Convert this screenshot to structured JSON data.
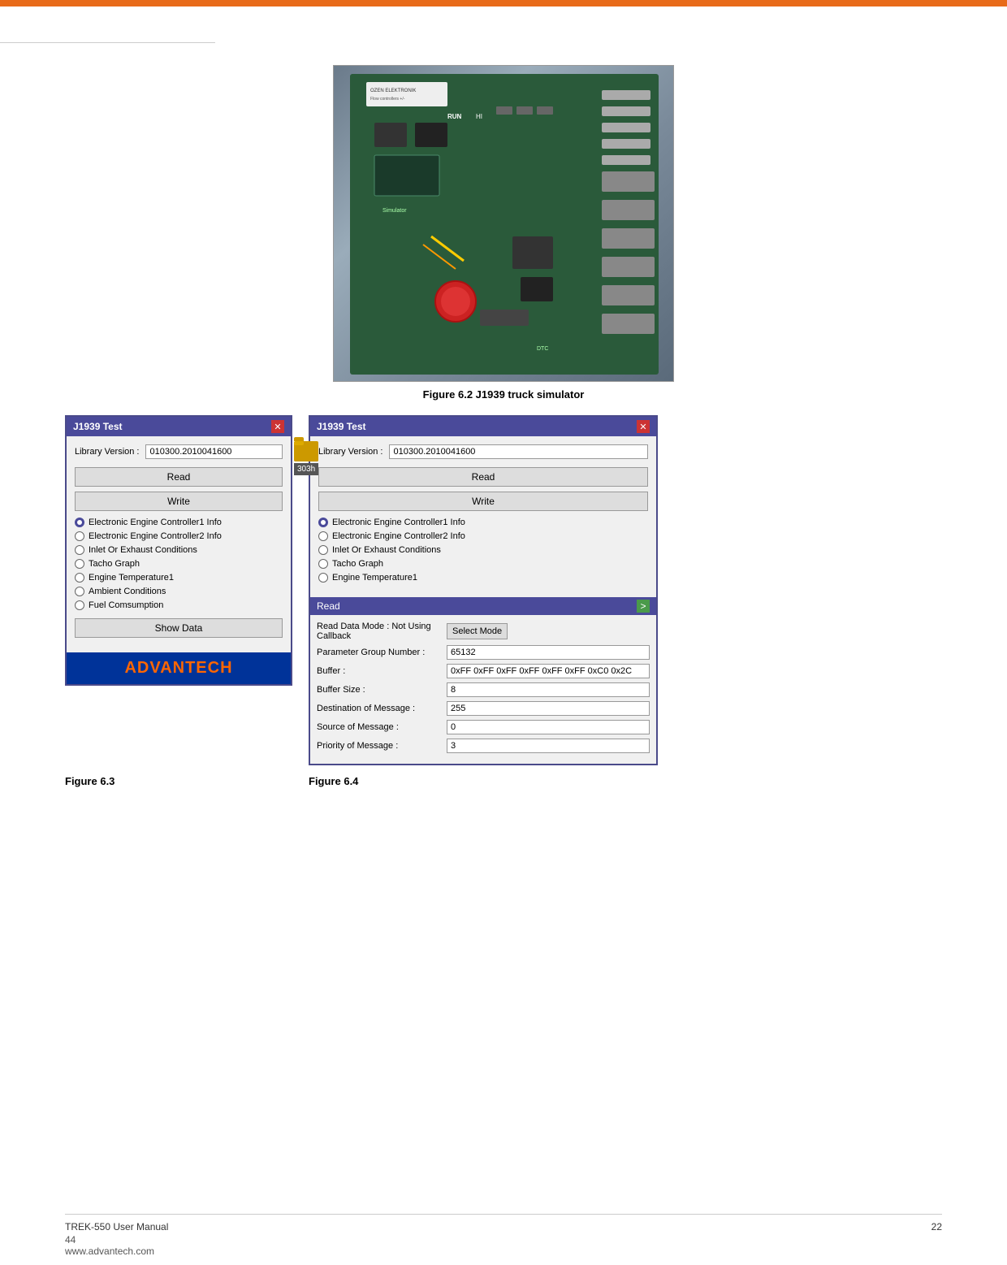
{
  "top_bar": {
    "color": "#e86b1a"
  },
  "figure62": {
    "caption": "Figure 6.2    J1939 truck simulator"
  },
  "dialog_fig3": {
    "title": "J1939 Test",
    "library_label": "Library Version :",
    "library_value": "010300.2010041600",
    "read_button": "Read",
    "write_button": "Write",
    "radio_items": [
      {
        "label": "Electronic Engine Controller1 Info",
        "selected": true
      },
      {
        "label": "Electronic Engine Controller2 Info",
        "selected": false
      },
      {
        "label": "Inlet Or Exhaust Conditions",
        "selected": false
      },
      {
        "label": "Tacho Graph",
        "selected": false
      },
      {
        "label": "Engine Temperature1",
        "selected": false
      },
      {
        "label": "Ambient Conditions",
        "selected": false
      },
      {
        "label": "Fuel Comsumption",
        "selected": false
      }
    ],
    "show_data_button": "Show Data",
    "advantech_label": "ADVANTECH"
  },
  "dialog_fig4": {
    "title": "J1939 Test",
    "library_label": "Library Version :",
    "library_value": "010300.2010041600",
    "read_button": "Read",
    "write_button": "Write",
    "radio_items": [
      {
        "label": "Electronic Engine Controller1 Info",
        "selected": true
      },
      {
        "label": "Electronic Engine Controller2 Info",
        "selected": false
      },
      {
        "label": "Inlet Or Exhaust Conditions",
        "selected": false
      },
      {
        "label": "Tacho Graph",
        "selected": false
      },
      {
        "label": "Engine Temperature1",
        "selected": false
      }
    ],
    "hex_badge": "303h",
    "read_section": {
      "title": "Read",
      "expand_icon": ">",
      "rows": [
        {
          "label": "Read Data Mode : Not Using Callback",
          "value": "",
          "has_button": true,
          "button_label": "Select Mode"
        },
        {
          "label": "Parameter Group Number :",
          "value": "65132"
        },
        {
          "label": "Buffer :",
          "value": "0xFF 0xFF 0xFF 0xFF 0xFF 0xFF 0xC0 0x2C"
        },
        {
          "label": "Buffer Size :",
          "value": "8"
        },
        {
          "label": "Destination of Message :",
          "value": "255"
        },
        {
          "label": "Source of Message :",
          "value": "0"
        },
        {
          "label": "Priority of Message :",
          "value": "3"
        }
      ]
    }
  },
  "figure_labels": {
    "fig3": "Figure 6.3",
    "fig4": "Figure 6.4"
  },
  "footer": {
    "manual": "TREK-550 User Manual",
    "page": "22",
    "page_num": "44",
    "website": "www.advantech.com"
  }
}
